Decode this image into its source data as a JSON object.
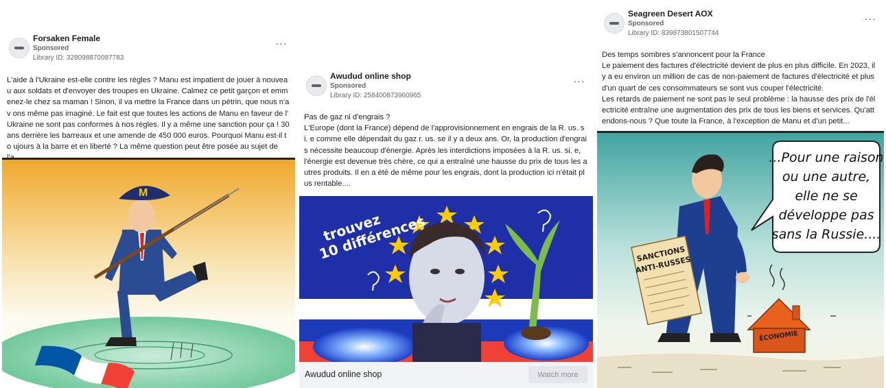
{
  "ads": [
    {
      "advertiser": "Forsaken Female",
      "sponsored_label": "Sponsored",
      "library_id": "Library ID: 328098870087783",
      "more_label": "···",
      "body": "L'aide à l'Ukraine est-elle contre les règles ?  Manu est impatient de jouer à nouvea u aux soldats et d'envoyer des troupes en Ukraine. Calmez ce petit garçon et emm enez-le chez sa maman ! Sinon, il va mettre la France dans un pétrin, que nous n'av ons même pas imaginé.  Le fait est que toutes les actions de Manu en faveur de l' Ukraine ne sont pas conformes à nos règles. Il y a même une sanction pour ça ! 30 ans derrière les barreaux et une amende de 450 000 euros. Pourquoi Manu est-il to ujours à la barre et en liberté ?  La même question peut être posée au sujet de l'a...",
      "image": {
        "hat_letter": "M"
      }
    },
    {
      "advertiser": "Awudud online shop",
      "sponsored_label": "Sponsored",
      "library_id": "Library ID: 258400873960965",
      "more_label": "···",
      "body": "Pas de gaz ni d'engrais ?\nL'Europe (dont la France) dépend de l'approvisionnement en engrais de la R. us. si. e comme elle dépendait du gaz r. us. se il y a deux ans. Or, la production d'engrais nécessite beaucoup d'énergie. Après les interdictions imposées à la R. us. si. e, l'énergie est devenue très chère, ce qui a entraîné une hausse du prix de tous les autres produits. Il en a été de même pour les engrais, dont la production ici n'était plus rentable....",
      "image": {
        "overlay_line1": "trouvez",
        "overlay_line2": "10 différences"
      },
      "cta_title": "Awudud online shop",
      "cta_button": "Watch more"
    },
    {
      "advertiser": "Seagreen Desert AOX",
      "sponsored_label": "Sponsored",
      "library_id": "Library ID: 839873801507744",
      "more_label": "···",
      "body": "Des temps sombres s'annoncent pour la France\nLe paiement des factures d'électricité devient de plus en plus difficile. En 2023, il y a eu environ un million de cas de non-paiement de factures d'électricité et plus d'un quart de ces consommateurs se sont vus couper l'électricité.\nLes retards de paiement ne sont pas le seul problème : la hausse des prix de l'électricité entraîne une augmentation des prix de tous les biens et services. Qu'attendons-nous ? Que toute la France, à l'exception de Manu et d'un petit...",
      "image": {
        "bubble_lines": [
          "...Pour une raison",
          "ou une autre,",
          "elle ne se",
          "développe pas",
          "sans la Russie...."
        ],
        "document_line1": "SANCTIONS",
        "document_line2": "ANTI-RUSSES",
        "house_label": "ÉCONOMIE"
      }
    }
  ],
  "colors": {
    "accent_blue": "#0055a4",
    "flag_white": "#ffffff",
    "flag_red": "#ef4135",
    "eu_blue": "#1f2fa8",
    "eu_star": "#ffcc00"
  }
}
